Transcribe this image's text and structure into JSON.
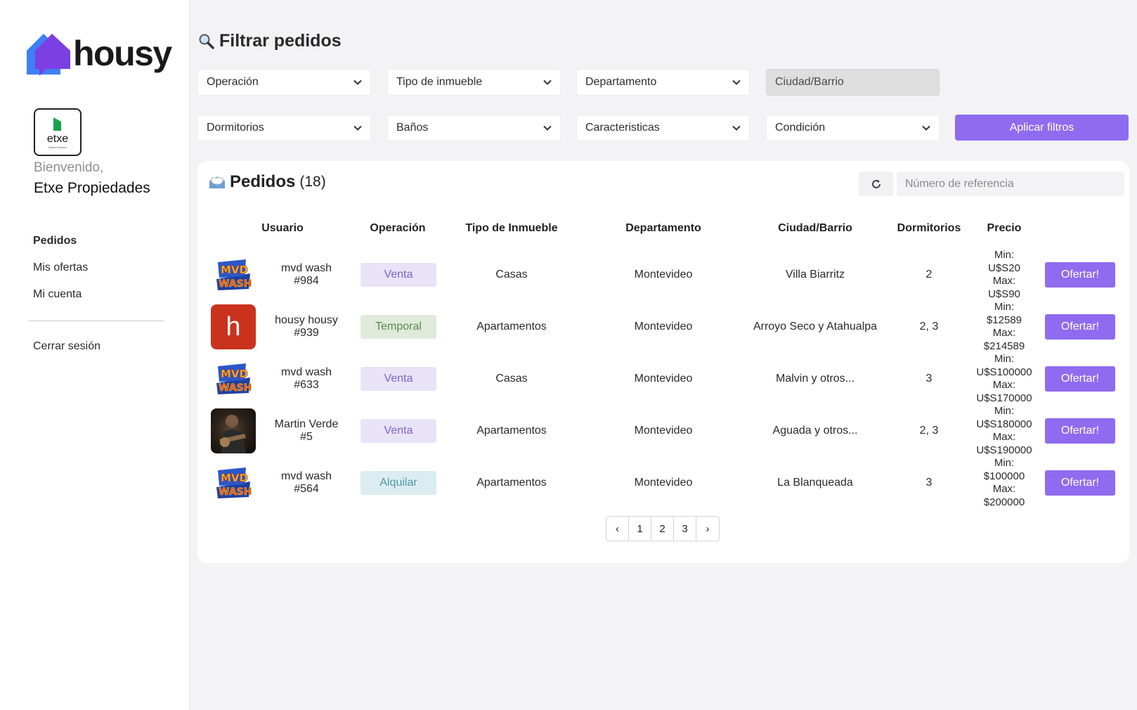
{
  "brand": {
    "name": "housy",
    "colors": {
      "primary": "#8f6bf0",
      "logo_blue": "#3d7ff5",
      "logo_purple": "#7b3fe4"
    }
  },
  "sidebar": {
    "org_logo_name": "etxe",
    "org_logo_sub": "Bienes Raíces",
    "welcome": "Bienvenido,",
    "company": "Etxe Propiedades",
    "nav": [
      {
        "label": "Pedidos",
        "active": true
      },
      {
        "label": "Mis ofertas",
        "active": false
      },
      {
        "label": "Mi cuenta",
        "active": false
      }
    ],
    "logout": "Cerrar sesión"
  },
  "filters": {
    "title": "Filtrar pedidos",
    "title_icon": "magnifier-icon",
    "row1": [
      "Operación",
      "Tipo de inmueble",
      "Departamento",
      "Ciudad/Barrio"
    ],
    "row2": [
      "Dormitorios",
      "Baños",
      "Caracteristicas",
      "Condición"
    ],
    "apply": "Aplicar filtros"
  },
  "orders": {
    "title": "Pedidos",
    "count": "(18)",
    "title_icon": "envelope-icon",
    "search_placeholder": "Número de referencia",
    "columns": [
      "Usuario",
      "Operación",
      "Tipo de Inmueble",
      "Departamento",
      "Ciudad/Barrio",
      "Dormitorios",
      "Precio"
    ],
    "offer_label": "Ofertar!",
    "rows": [
      {
        "avatar": "mvd-wash-logo",
        "user": "mvd wash",
        "id": "#984",
        "operation": "Venta",
        "op_style": "venta",
        "type": "Casas",
        "department": "Montevideo",
        "city": "Villa Biarritz",
        "bedrooms": "2",
        "price": [
          "Min:",
          "U$S20",
          "Max:",
          "U$S90"
        ]
      },
      {
        "avatar": "letter",
        "avatar_letter": "h",
        "user": "housy housy",
        "id": "#939",
        "operation": "Temporal",
        "op_style": "temporal",
        "type": "Apartamentos",
        "department": "Montevideo",
        "city": "Arroyo Seco y Atahualpa",
        "bedrooms": "2, 3",
        "price": [
          "Min:",
          "$12589",
          "Max:",
          "$214589"
        ]
      },
      {
        "avatar": "mvd-wash-logo",
        "user": "mvd wash",
        "id": "#633",
        "operation": "Venta",
        "op_style": "venta",
        "type": "Casas",
        "department": "Montevideo",
        "city": "Malvin y otros...",
        "bedrooms": "3",
        "price": [
          "Min:",
          "U$S100000",
          "Max:",
          "U$S170000"
        ]
      },
      {
        "avatar": "photo",
        "user": "Martin Verde",
        "id": "#5",
        "operation": "Venta",
        "op_style": "venta",
        "type": "Apartamentos",
        "department": "Montevideo",
        "city": "Aguada y otros...",
        "bedrooms": "2, 3",
        "price": [
          "Min:",
          "U$S180000",
          "Max:",
          "U$S190000"
        ]
      },
      {
        "avatar": "mvd-wash-logo",
        "user": "mvd wash",
        "id": "#564",
        "operation": "Alquilar",
        "op_style": "alquilar",
        "type": "Apartamentos",
        "department": "Montevideo",
        "city": "La Blanqueada",
        "bedrooms": "3",
        "price": [
          "Min:",
          "$100000",
          "Max:",
          "$200000"
        ]
      }
    ],
    "pagination": [
      "‹",
      "1",
      "2",
      "3",
      "›"
    ]
  }
}
